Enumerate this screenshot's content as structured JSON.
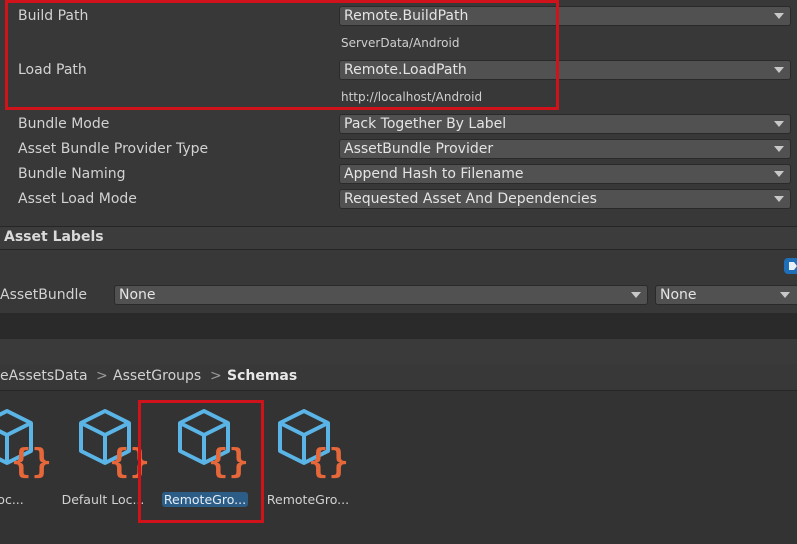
{
  "settings": {
    "build_path": {
      "label": "Build Path",
      "value": "Remote.BuildPath",
      "resolved": "ServerData/Android"
    },
    "load_path": {
      "label": "Load Path",
      "value": "Remote.LoadPath",
      "resolved": "http://localhost/Android"
    },
    "bundle_mode": {
      "label": "Bundle Mode",
      "value": "Pack Together By Label"
    },
    "provider_type": {
      "label": "Asset Bundle Provider Type",
      "value": "AssetBundle Provider"
    },
    "bundle_naming": {
      "label": "Bundle Naming",
      "value": "Append Hash to Filename"
    },
    "asset_load_mode": {
      "label": "Asset Load Mode",
      "value": "Requested Asset And Dependencies"
    }
  },
  "asset_labels": {
    "header": "Asset Labels",
    "assetbundle_label": "AssetBundle",
    "assetbundle_value": "None",
    "variant_value": "None"
  },
  "breadcrumb": {
    "items": [
      "eAssetsData",
      "AssetGroups",
      "Schemas"
    ],
    "separator": ">"
  },
  "assets": [
    {
      "label": "lt Loc...",
      "selected": false
    },
    {
      "label": "Default Loc...",
      "selected": false
    },
    {
      "label": "RemoteGro...",
      "selected": true
    },
    {
      "label": "RemoteGro...",
      "selected": false
    }
  ],
  "colors": {
    "background": "#383838",
    "highlight_box": "#d0121b",
    "selection": "#2c5d87",
    "cube_icon": "#5ab5e6",
    "braces_icon": "#e5673a"
  },
  "icons": {
    "asset": "script-schema-icon",
    "labels_tag": "tag-icon"
  }
}
